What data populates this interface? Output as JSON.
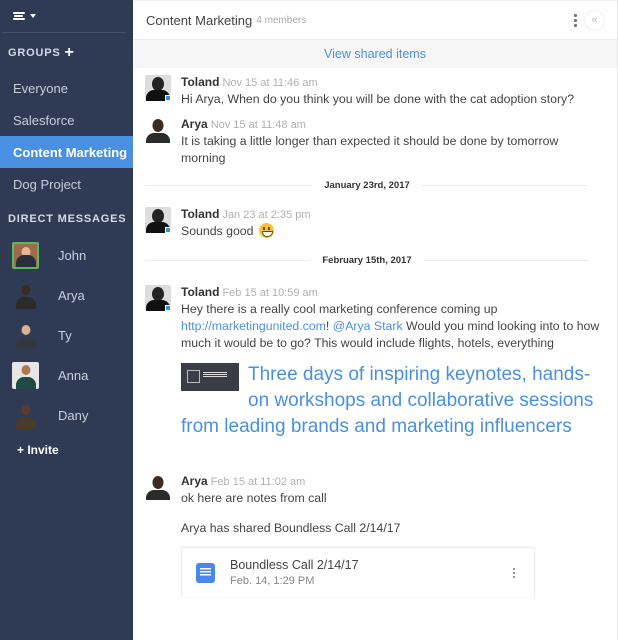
{
  "sidebar": {
    "logo_icon": "stack-logo-icon",
    "groups_heading": "GROUPS",
    "groups": [
      {
        "label": "Everyone",
        "active": false
      },
      {
        "label": "Salesforce",
        "active": false
      },
      {
        "label": "Content Marketing",
        "active": true
      },
      {
        "label": "Dog Project",
        "active": false
      }
    ],
    "dm_heading": "DIRECT MESSAGES",
    "direct_messages": [
      {
        "label": "John",
        "online": true
      },
      {
        "label": "Arya",
        "online": false
      },
      {
        "label": "Ty",
        "online": false
      },
      {
        "label": "Anna",
        "online": false
      },
      {
        "label": "Dany",
        "online": false
      }
    ],
    "invite_label": "+ Invite"
  },
  "header": {
    "title": "Content Marketing",
    "members": "4 members",
    "collapse_glyph": "«"
  },
  "shared_items_link": "View shared items",
  "messages": [
    {
      "author": "Toland",
      "time": "Nov 15 at 11:46 am",
      "text": "Hi Arya, When do you think you will be done with the cat adoption story?"
    },
    {
      "author": "Arya",
      "time": "Nov 15 at 11:48 am",
      "text": "It is taking a little longer than expected it should be done by tomorrow morning"
    }
  ],
  "divider_1": "January 23rd, 2017",
  "message_3": {
    "author": "Toland",
    "time": "Jan 23 at 2:35 pm",
    "text": "Sounds good",
    "emoji": "smiley"
  },
  "divider_2": "February 15th, 2017",
  "message_4": {
    "author": "Toland",
    "time": "Feb 15 at 10:59 am",
    "text_before": "Hey there is a really cool marketing conference coming up ",
    "link": "http://marketingunited.com",
    "after_link": "! ",
    "mention": "@Arya Stark",
    "text_after": " Would you mind looking into to how much it would be to go? This would include flights, hotels, everything",
    "preview_text": "Three days of inspiring keynotes, hands-on workshops and collaborative sessions from leading brands and marketing influencers"
  },
  "message_5": {
    "author": "Arya",
    "time": "Feb 15 at 11:02 am",
    "text": "ok here are notes from call",
    "shared_note": "Arya has shared Boundless Call 2/14/17",
    "file": {
      "name": "Boundless Call 2/14/17",
      "date": "Feb. 14, 1:29 PM"
    }
  }
}
